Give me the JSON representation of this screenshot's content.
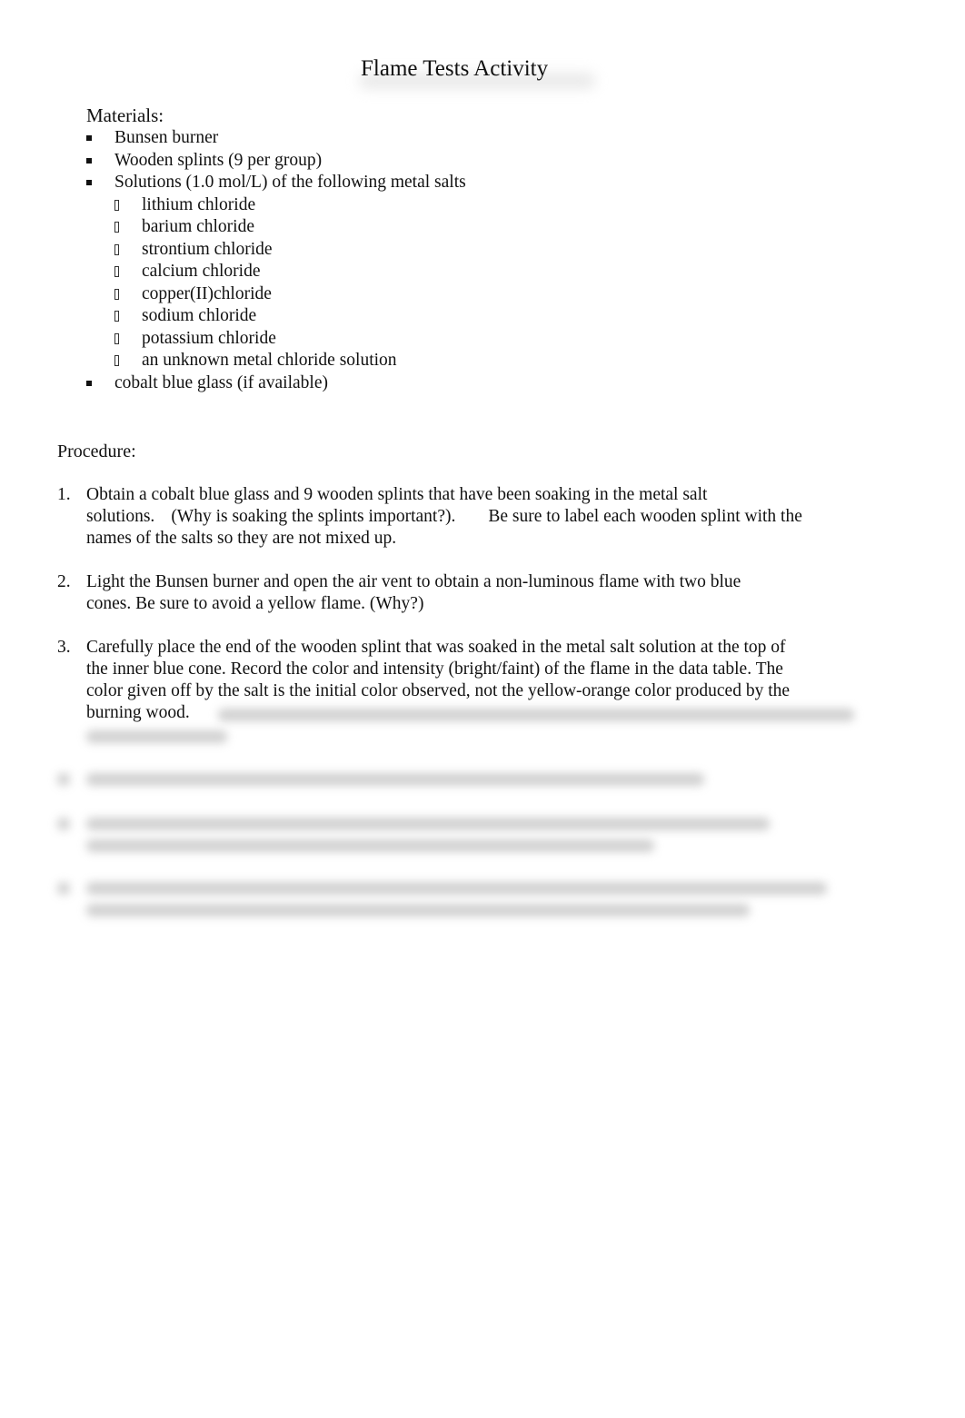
{
  "document": {
    "title": "Flame Tests Activity",
    "materials": {
      "heading": "Materials:",
      "items": [
        {
          "label": "Bunsen burner"
        },
        {
          "label": "Wooden splints (9 per group)"
        },
        {
          "label": "Solutions (1.0 mol/L) of the following metal salts",
          "subitems": [
            "lithium chloride",
            "barium chloride",
            "strontium chloride",
            "calcium chloride",
            "copper(II)chloride",
            "sodium chloride",
            "potassium chloride",
            "an unknown metal chloride solution"
          ]
        },
        {
          "label": "cobalt blue glass (if available)"
        }
      ]
    },
    "procedure": {
      "heading": "Procedure:",
      "steps": [
        {
          "number": "1.",
          "lines": [
            "Obtain a cobalt blue glass and 9 wooden splints that have been soaking in the metal salt",
            "solutions.",
            "(Why is soaking the splints important?).",
            "Be sure to label each wooden splint with the",
            "names of the salts so they are not mixed up."
          ]
        },
        {
          "number": "2.",
          "lines": [
            "Light the Bunsen burner and open the air vent to obtain a non-luminous flame with two blue",
            "cones. Be sure to avoid a yellow flame. (Why?)"
          ]
        },
        {
          "number": "3.",
          "lines": [
            "Carefully place the end of the wooden splint that was soaked in the metal salt solution at the top of",
            "the inner blue cone. Record the color and intensity (bright/faint) of the flame in the data table. The",
            "color given off by the salt is the initial color observed, not the yellow-orange color produced by the",
            "burning wood."
          ]
        }
      ],
      "obscured_note": "Remaining text is blurred and unreadable"
    }
  }
}
